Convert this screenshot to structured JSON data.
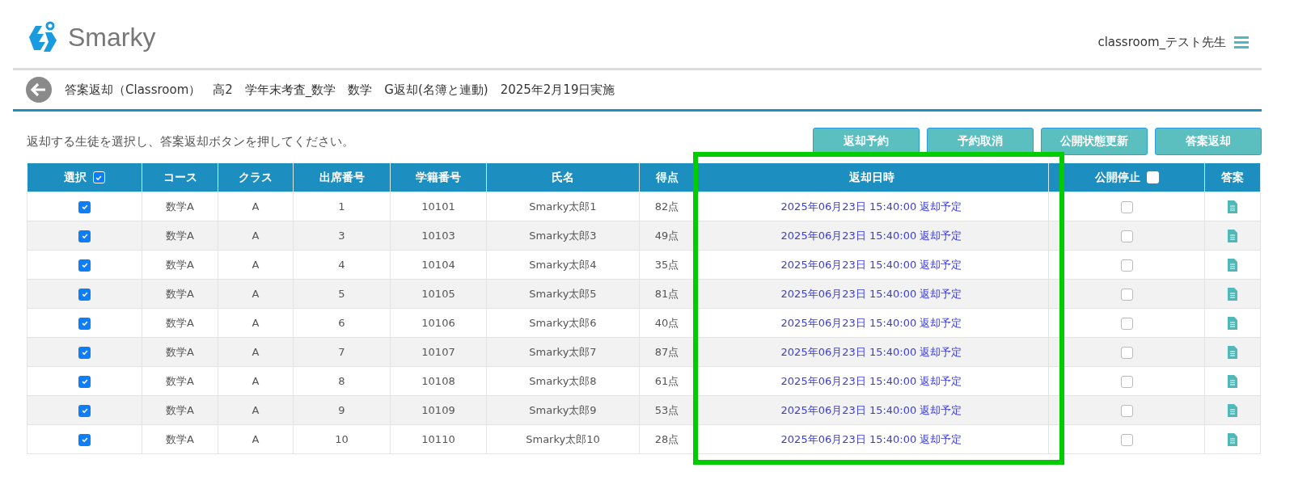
{
  "header": {
    "brand": "Smarky",
    "user": "classroom_テスト先生"
  },
  "breadcrumb": {
    "text": "答案返却（Classroom）　高2　学年末考査_数学　数学　G返却(名簿と連動)　2025年2月19日実施"
  },
  "instruction": "返却する生徒を選択し、答案返却ボタンを押してください。",
  "buttons": [
    "返却予約",
    "予約取消",
    "公開状態更新",
    "答案返却"
  ],
  "table": {
    "columns": [
      {
        "label": "選択",
        "kind": "checkbox",
        "checked": true
      },
      {
        "label": "コース",
        "kind": "text"
      },
      {
        "label": "クラス",
        "kind": "text"
      },
      {
        "label": "出席番号",
        "kind": "text"
      },
      {
        "label": "学籍番号",
        "kind": "text"
      },
      {
        "label": "氏名",
        "kind": "text"
      },
      {
        "label": "得点",
        "kind": "text"
      },
      {
        "label": "返却日時",
        "kind": "text"
      },
      {
        "label": "公開停止",
        "kind": "checkbox",
        "checked": false
      },
      {
        "label": "答案",
        "kind": "text"
      }
    ],
    "rows": [
      {
        "selected": true,
        "course": "数学A",
        "class": "A",
        "attendance_no": "1",
        "student_id": "10101",
        "name": "Smarky太郎1",
        "score": "82点",
        "return_datetime": "2025年06月23日 15:40:00 返却予定",
        "publish_stopped": false
      },
      {
        "selected": true,
        "course": "数学A",
        "class": "A",
        "attendance_no": "3",
        "student_id": "10103",
        "name": "Smarky太郎3",
        "score": "49点",
        "return_datetime": "2025年06月23日 15:40:00 返却予定",
        "publish_stopped": false
      },
      {
        "selected": true,
        "course": "数学A",
        "class": "A",
        "attendance_no": "4",
        "student_id": "10104",
        "name": "Smarky太郎4",
        "score": "35点",
        "return_datetime": "2025年06月23日 15:40:00 返却予定",
        "publish_stopped": false
      },
      {
        "selected": true,
        "course": "数学A",
        "class": "A",
        "attendance_no": "5",
        "student_id": "10105",
        "name": "Smarky太郎5",
        "score": "81点",
        "return_datetime": "2025年06月23日 15:40:00 返却予定",
        "publish_stopped": false
      },
      {
        "selected": true,
        "course": "数学A",
        "class": "A",
        "attendance_no": "6",
        "student_id": "10106",
        "name": "Smarky太郎6",
        "score": "40点",
        "return_datetime": "2025年06月23日 15:40:00 返却予定",
        "publish_stopped": false
      },
      {
        "selected": true,
        "course": "数学A",
        "class": "A",
        "attendance_no": "7",
        "student_id": "10107",
        "name": "Smarky太郎7",
        "score": "87点",
        "return_datetime": "2025年06月23日 15:40:00 返却予定",
        "publish_stopped": false
      },
      {
        "selected": true,
        "course": "数学A",
        "class": "A",
        "attendance_no": "8",
        "student_id": "10108",
        "name": "Smarky太郎8",
        "score": "61点",
        "return_datetime": "2025年06月23日 15:40:00 返却予定",
        "publish_stopped": false
      },
      {
        "selected": true,
        "course": "数学A",
        "class": "A",
        "attendance_no": "9",
        "student_id": "10109",
        "name": "Smarky太郎9",
        "score": "53点",
        "return_datetime": "2025年06月23日 15:40:00 返却予定",
        "publish_stopped": false
      },
      {
        "selected": true,
        "course": "数学A",
        "class": "A",
        "attendance_no": "10",
        "student_id": "10110",
        "name": "Smarky太郎10",
        "score": "28点",
        "return_datetime": "2025年06月23日 15:40:00 返却予定",
        "publish_stopped": false
      }
    ]
  }
}
